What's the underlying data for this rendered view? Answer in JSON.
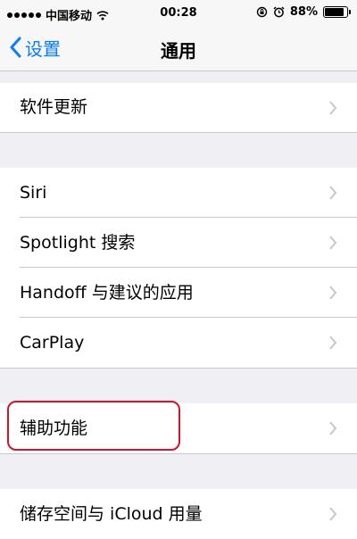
{
  "status_bar": {
    "carrier": "中国移动",
    "time": "00:28",
    "battery": "88%",
    "battery_level": 0.88,
    "icons": [
      "signal-dots",
      "wifi-icon",
      "lock-rotation-icon",
      "alarm-icon",
      "battery-icon"
    ]
  },
  "nav": {
    "back_label": "设置",
    "title": "通用"
  },
  "rows": {
    "software_update": "软件更新",
    "siri": "Siri",
    "spotlight": "Spotlight 搜索",
    "handoff": "Handoff 与建议的应用",
    "carplay": "CarPlay",
    "accessibility": "辅助功能",
    "storage": "储存空间与 iCloud 用量"
  },
  "colors": {
    "accent": "#0a7cff",
    "highlight": "#d0142c",
    "background": "#efeff4",
    "separator": "#c8c7cc",
    "chevron": "#c7c7cc"
  }
}
